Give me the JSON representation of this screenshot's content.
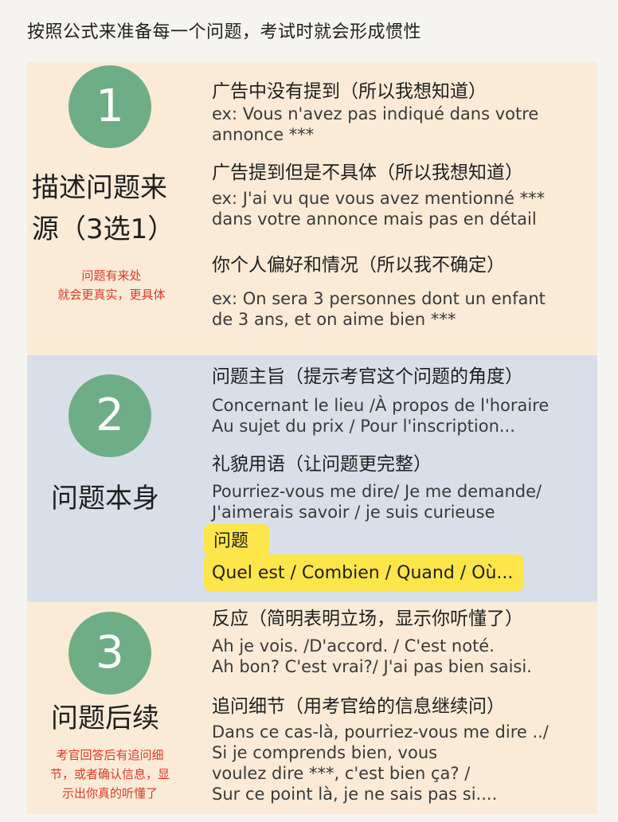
{
  "header": {
    "title": "按照公式来准备每一个问题，考试时就会形成惯性"
  },
  "sections": [
    {
      "number": "1",
      "left_title": "描述问题来源（3选1）",
      "left_title_lines": [
        "描述问题来",
        "源（3选1）"
      ],
      "note_lines": [
        "问题有来处",
        "就会更真实，更具体"
      ],
      "items": [
        {
          "title": "广告中没有提到（所以我想知道）",
          "example": [
            "ex: Vous n'avez pas indiqué dans votre",
            "annonce ***"
          ]
        },
        {
          "title": "广告提到但是不具体（所以我想知道）",
          "example": [
            "ex: J'ai vu que vous avez mentionné ***",
            "dans votre annonce mais pas en détail"
          ]
        },
        {
          "title": "你个人偏好和情况（所以我不确定）",
          "example": [
            "ex: On sera 3 personnes dont un enfant",
            "de 3 ans, et on aime bien ***"
          ]
        }
      ]
    },
    {
      "number": "2",
      "left_title": "问题本身",
      "items": [
        {
          "title": "问题主旨（提示考官这个问题的角度）",
          "example": [
            "Concernant le lieu /À propos de l'horaire",
            "Au sujet du prix / Pour l'inscription..."
          ]
        },
        {
          "title": "礼貌用语（让问题更完整）",
          "example": [
            "Pourriez-vous me dire/ Je me demande/",
            "J'aimerais savoir / je suis curieuse"
          ]
        }
      ],
      "highlight": {
        "title": "问题",
        "example": "Quel est / Combien / Quand / Où..."
      }
    },
    {
      "number": "3",
      "left_title": "问题后续",
      "note_lines": [
        "考官回答后有追问细",
        "节，或者确认信息，显",
        "示出你真的听懂了"
      ],
      "items": [
        {
          "title": "反应（简明表明立场，显示你听懂了）",
          "example": [
            "Ah je vois. /D'accord. / C'est noté.",
            "Ah bon? C'est vrai?/ J'ai pas bien saisi."
          ]
        },
        {
          "title": "追问细节（用考官给的信息继续问）",
          "example": [
            "Dans ce cas-là, pourriez-vous me dire ../",
            "Si je comprends bien, vous",
            "voulez dire ***, c'est bien ça? /",
            "Sur ce point là, je ne sais pas si...."
          ]
        }
      ]
    }
  ]
}
